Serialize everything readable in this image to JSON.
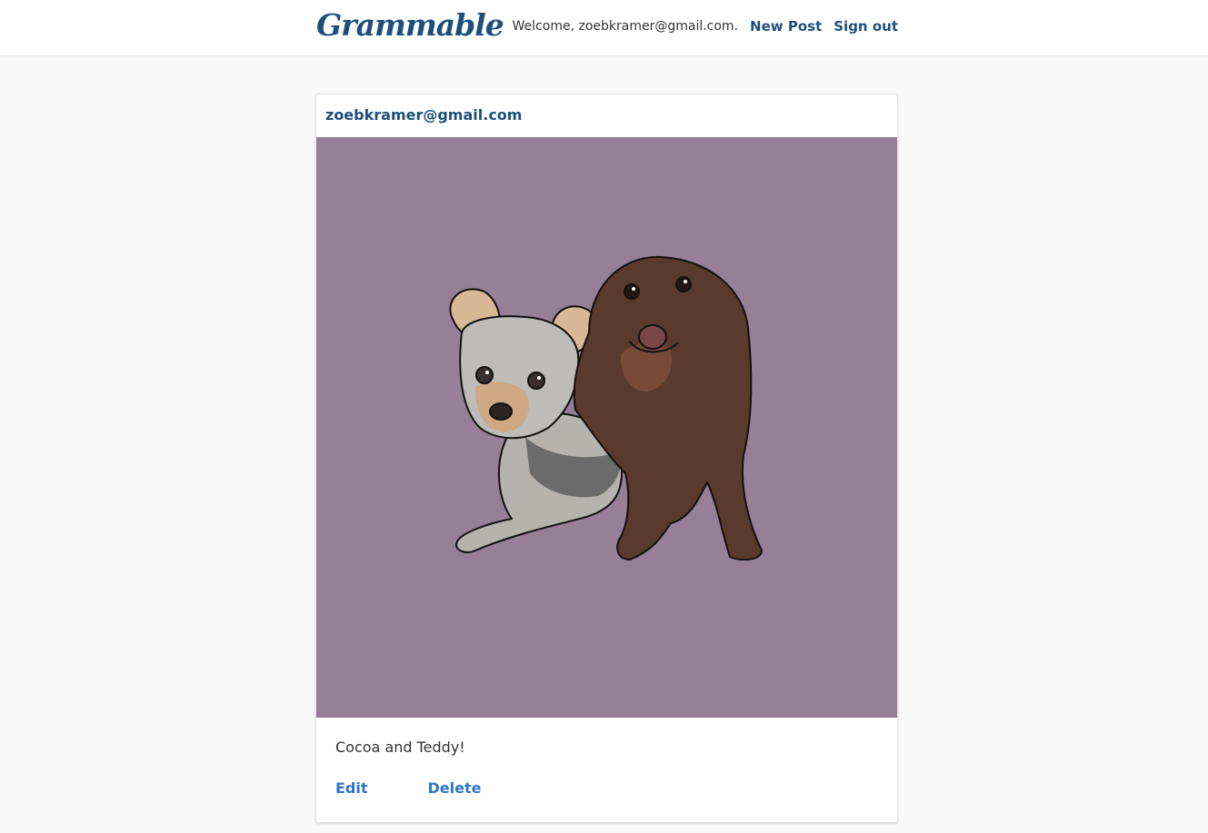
{
  "navbar": {
    "brand": "Grammable",
    "welcome_text": "Welcome, zoebkramer@gmail.com.",
    "new_post_label": "New Post",
    "sign_out_label": "Sign out"
  },
  "post": {
    "author": "zoebkramer@gmail.com",
    "image_background": "#967f97",
    "caption": "Cocoa and Teddy!",
    "edit_label": "Edit",
    "delete_label": "Delete"
  },
  "colors": {
    "brand": "#1d4f7c",
    "action_link": "#2d75c6",
    "page_background": "#f9f9f9"
  }
}
